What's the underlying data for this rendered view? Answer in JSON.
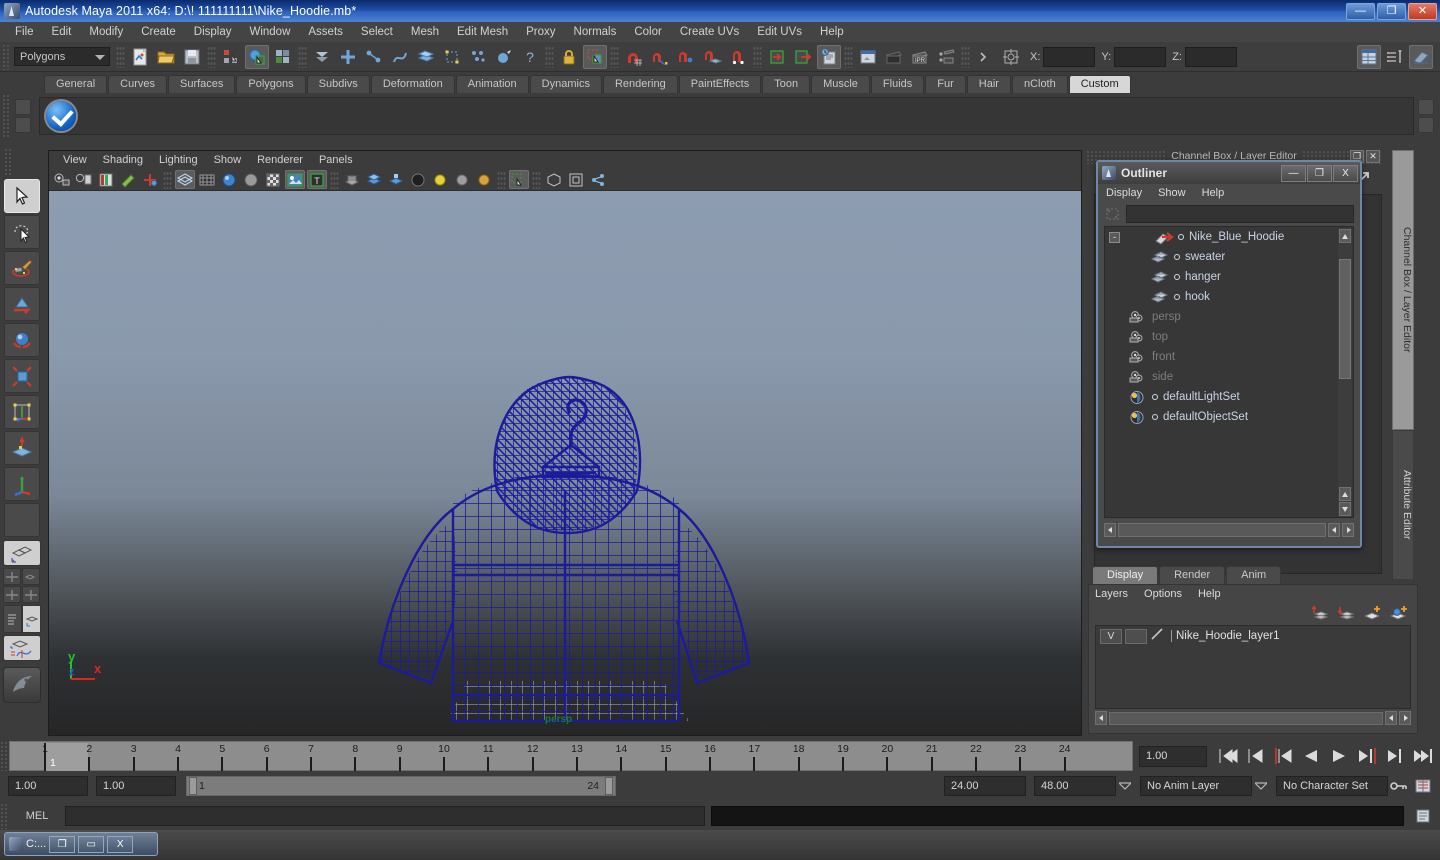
{
  "window": {
    "title": "Autodesk Maya 2011 x64: D:\\! 111111111\\Nike_Hoodie.mb*",
    "minimize": "—",
    "maximize": "❐",
    "close": "✕"
  },
  "menu": {
    "items": [
      "File",
      "Edit",
      "Modify",
      "Create",
      "Display",
      "Window",
      "Assets",
      "Select",
      "Mesh",
      "Edit Mesh",
      "Proxy",
      "Normals",
      "Color",
      "Create UVs",
      "Edit UVs",
      "Help"
    ]
  },
  "status_line": {
    "menu_set": "Polygons",
    "x_label": "X:",
    "y_label": "Y:",
    "z_label": "Z:",
    "x_value": "",
    "y_value": "",
    "z_value": ""
  },
  "shelf": {
    "tabs": [
      "General",
      "Curves",
      "Surfaces",
      "Polygons",
      "Subdivs",
      "Deformation",
      "Animation",
      "Dynamics",
      "Rendering",
      "PaintEffects",
      "Toon",
      "Muscle",
      "Fluids",
      "Fur",
      "Hair",
      "nCloth",
      "Custom"
    ],
    "selected_tab": "Custom",
    "buttons": [
      {
        "name": "blue-check-shelf-button"
      }
    ]
  },
  "toolbox": {
    "items": [
      {
        "name": "select-tool",
        "selected": true
      },
      {
        "name": "lasso-select-tool",
        "selected": false
      },
      {
        "name": "paint-select-tool",
        "selected": false
      },
      {
        "name": "move-tool",
        "selected": false
      },
      {
        "name": "rotate-tool",
        "selected": false
      },
      {
        "name": "scale-tool",
        "selected": false
      },
      {
        "name": "universal-manipulator-tool",
        "selected": false
      },
      {
        "name": "soft-modification-tool",
        "selected": false
      },
      {
        "name": "last-tool-used",
        "selected": false
      },
      {
        "name": "blank-tool-slot",
        "selected": false
      }
    ],
    "layout_presets": [
      "single-perspective-view",
      "four-view",
      "two-panes-side",
      "two-panes-stacked",
      "outliner-persp",
      "hypershade-persp",
      "persp-graph-editor"
    ]
  },
  "viewport": {
    "menus": [
      "View",
      "Shading",
      "Lighting",
      "Show",
      "Renderer",
      "Panels"
    ],
    "camera_label": "persp",
    "axis_labels": {
      "x": "x",
      "y": "y",
      "z": "z"
    },
    "wireframe_color": "#1a1a9e",
    "object": "Nike_Blue_Hoodie",
    "background_top": "#8d9cb0",
    "background_bottom": "#262626"
  },
  "channel_box": {
    "header": "Channel Box / Layer Editor",
    "restore": "❐",
    "close": "✕",
    "side_tabs": [
      "Channel Box / Layer Editor",
      "Attribute Editor"
    ]
  },
  "outliner": {
    "title": "Outliner",
    "minimize": "—",
    "maximize": "❐",
    "close": "X",
    "menus": [
      "Display",
      "Show",
      "Help"
    ],
    "search_value": "",
    "expander": "-",
    "items": [
      {
        "label": "Nike_Blue_Hoodie",
        "icon": "transform-icon",
        "depth": 0,
        "dim": false,
        "expandable": true
      },
      {
        "label": "sweater",
        "icon": "mesh-icon",
        "depth": 1,
        "dim": false,
        "expandable": false
      },
      {
        "label": "hanger",
        "icon": "mesh-icon",
        "depth": 1,
        "dim": false,
        "expandable": false
      },
      {
        "label": "hook",
        "icon": "mesh-icon",
        "depth": 1,
        "dim": false,
        "expandable": false
      },
      {
        "label": "persp",
        "icon": "camera-icon",
        "depth": 0,
        "dim": true,
        "expandable": false
      },
      {
        "label": "top",
        "icon": "camera-icon",
        "depth": 0,
        "dim": true,
        "expandable": false
      },
      {
        "label": "front",
        "icon": "camera-icon",
        "depth": 0,
        "dim": true,
        "expandable": false
      },
      {
        "label": "side",
        "icon": "camera-icon",
        "depth": 0,
        "dim": true,
        "expandable": false
      },
      {
        "label": "defaultLightSet",
        "icon": "set-icon",
        "depth": 0,
        "dim": false,
        "expandable": false
      },
      {
        "label": "defaultObjectSet",
        "icon": "set-icon",
        "depth": 0,
        "dim": false,
        "expandable": false
      }
    ]
  },
  "layer_editor": {
    "tabs": [
      "Display",
      "Render",
      "Anim"
    ],
    "selected_tab": "Display",
    "menus": [
      "Layers",
      "Options",
      "Help"
    ],
    "layers": [
      {
        "visibility": "V",
        "type": "",
        "name": "Nike_Hoodie_layer1"
      }
    ]
  },
  "timeline": {
    "ticks": [
      "1",
      "2",
      "3",
      "4",
      "5",
      "6",
      "7",
      "8",
      "9",
      "10",
      "11",
      "12",
      "13",
      "14",
      "15",
      "16",
      "17",
      "18",
      "19",
      "20",
      "21",
      "22",
      "23",
      "24"
    ],
    "current_frame": "1",
    "current_frame_field": "1.00"
  },
  "range_slider": {
    "anim_start": "1.00",
    "anim_end": "1.00",
    "range_start": "1",
    "range_end": "24",
    "playback_end": "24.00",
    "anim_end_total": "48.00",
    "anim_layer": "No Anim Layer",
    "character_set": "No Character Set"
  },
  "playback": {
    "buttons": [
      "go-to-start",
      "step-back-key",
      "step-back-frame",
      "play-backwards",
      "play-forwards",
      "step-forward-frame",
      "step-forward-key",
      "go-to-end"
    ]
  },
  "command_line": {
    "language_label": "MEL",
    "input_value": "",
    "output_value": ""
  },
  "taskbar": {
    "item_label": "C:...",
    "restore": "❐",
    "maximize": "▭",
    "close": "X"
  }
}
